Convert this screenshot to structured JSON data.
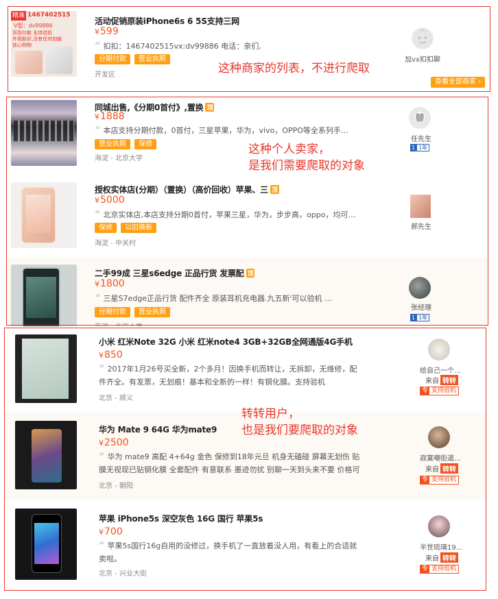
{
  "listings": [
    {
      "title": "活动促销原装iPhone6s 6 5S支持三网",
      "currency": "¥",
      "price": "599",
      "desc": "扣扣：1467402515vx:dv99886 电话：亲们,",
      "tags": [
        "分期付款",
        "营业执照"
      ],
      "location": "开发区",
      "thumb_banner": "精准",
      "thumb_lines": [
        "1467402515",
        "V型：dv99886",
        "货到付款 支持验机",
        "外观新好,没有任何划痕",
        "放心购物"
      ],
      "contact_label": "加vx扣扣聊",
      "view_all_label": "查看全部商家"
    },
    {
      "title": "同城出售,《分期0首付》,置换",
      "ding": "顶",
      "currency": "¥",
      "price": "1888",
      "desc": "本店支持分期付款，0首付，三星苹果，华为，vivo，OPPO等全系列手…",
      "tags": [
        "营业执照",
        "保修"
      ],
      "location": "海淀 - 北京大学",
      "seller": "任先生",
      "level_a": "1",
      "level_b": "1年"
    },
    {
      "title": "授权实体店(分期）（置换）（高价回收）苹果、三",
      "ding": "顶",
      "currency": "¥",
      "price": "5000",
      "desc": "北京实体店,本店支持分期0首付，苹果三星，华为，步步高，oppo，均可…",
      "tags": [
        "保修",
        "以旧换新"
      ],
      "location": "海淀 - 中关村",
      "seller": "郝先生"
    },
    {
      "title": "二手99成 三星s6edge 正品行货 发票配",
      "ding": "顶",
      "currency": "¥",
      "price": "1800",
      "desc": "三星S7edge正品行货 配件齐全 原装耳机充电器.九五新'可以验机 …",
      "tags": [
        "分期付款",
        "营业执照"
      ],
      "location": "海淀 - 北京大学",
      "seller": "张经理",
      "level_a": "1",
      "level_b": "1年"
    },
    {
      "title": "小米 红米Note 32G 小米 红米note4 3GB+32GB全网通版4G手机",
      "currency": "¥",
      "price": "850",
      "desc": "2017年1月26号买全新，2个多月！因换手机而转让，无拆卸，无维修，配件齐全。有发票，无划痕！基本和全新的一样！有钢化膜。支持验机",
      "location": "北京 - 顺义",
      "seller": "给自己一个…",
      "from_label": "来自",
      "from_badge": "转转",
      "verify_icon": "专",
      "verify_label": "支持验机"
    },
    {
      "title": "华为 Mate 9 64G 华为mate9",
      "currency": "¥",
      "price": "2500",
      "desc": "华为 mate9 高配 4+64g 金色 保修到18年元旦 机身无磕碰 屏幕无划伤 贴膜无视现已贴钢化膜 全套配件 有意联系 墨迹勿扰 别聊一天到头来不要 价格可小…",
      "location": "北京 - 朝阳",
      "seller": "寂寞嘲街道…",
      "from_label": "来自",
      "from_badge": "转转",
      "verify_icon": "专",
      "verify_label": "支持验机"
    },
    {
      "title": "苹果 iPhone5s 深空灰色 16G 国行 苹果5s",
      "currency": "¥",
      "price": "700",
      "desc": "苹果5s国行16g自用的没修过，换手机了一直放着没人用，有看上的合适就卖啦。",
      "location": "北京 - 兴业大街",
      "seller": "半世琉璃19…",
      "from_label": "来自",
      "from_badge": "转转",
      "verify_icon": "专",
      "verify_label": "支持验机"
    }
  ],
  "annotations": {
    "merchant": "这种商家的列表，不进行爬取",
    "personal_1": "这种个人卖家，",
    "personal_2": "是我们需要爬取的对象",
    "zhuanzhuan_1": "转转用户，",
    "zhuanzhuan_2": "也是我们要爬取的对象"
  },
  "colors": {
    "price": "#f1521e",
    "tag": "#ffa014",
    "annotation": "#e8372c",
    "alt_row": "#fdf9f4"
  }
}
